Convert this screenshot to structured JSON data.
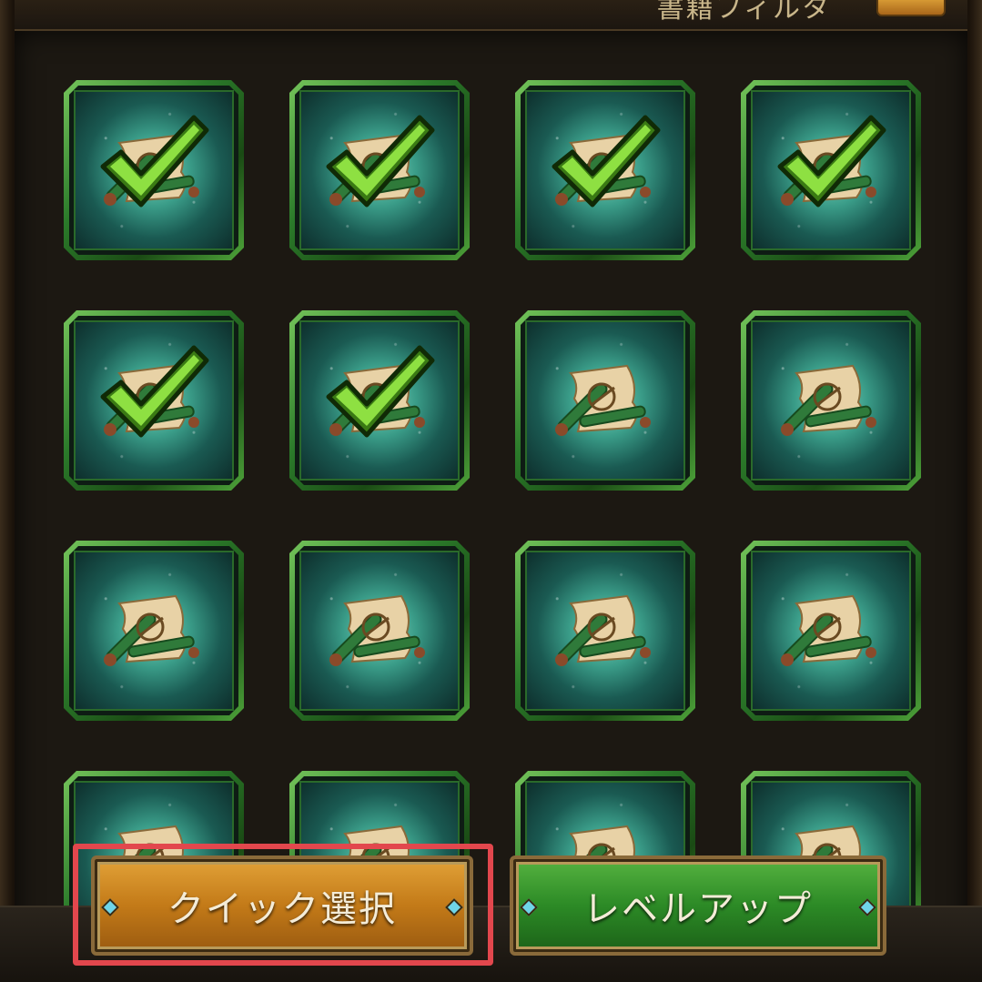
{
  "header": {
    "title": "書籍フィルタ"
  },
  "grid": {
    "tiles": [
      {
        "checked": true,
        "scroll_icon": "horse-scroll-icon"
      },
      {
        "checked": true,
        "scroll_icon": "shield-scroll-icon"
      },
      {
        "checked": true,
        "scroll_icon": "bow-scroll-icon"
      },
      {
        "checked": true,
        "scroll_icon": "catapult-scroll-icon"
      },
      {
        "checked": true,
        "scroll_icon": "horse-scroll-icon"
      },
      {
        "checked": true,
        "scroll_icon": "shield-scroll-icon"
      },
      {
        "checked": false,
        "scroll_icon": "bow-scroll-icon"
      },
      {
        "checked": false,
        "scroll_icon": "catapult-scroll-icon"
      },
      {
        "checked": false,
        "scroll_icon": "shield-scroll-icon"
      },
      {
        "checked": false,
        "scroll_icon": "catapult-scroll-icon"
      },
      {
        "checked": false,
        "scroll_icon": "catapult-scroll-icon"
      },
      {
        "checked": false,
        "scroll_icon": "catapult-scroll-icon"
      },
      {
        "checked": false,
        "scroll_icon": "scroll-icon"
      },
      {
        "checked": false,
        "scroll_icon": "scroll-icon"
      },
      {
        "checked": false,
        "scroll_icon": "scroll-icon"
      },
      {
        "checked": false,
        "scroll_icon": "scroll-icon"
      }
    ]
  },
  "actions": {
    "quick_select_label": "クイック選択",
    "level_up_label": "レベルアップ"
  },
  "colors": {
    "quick_select": "#c37a18",
    "level_up": "#2c8a26",
    "highlight": "#e2474d",
    "tile_border": "#2b7a2a"
  }
}
